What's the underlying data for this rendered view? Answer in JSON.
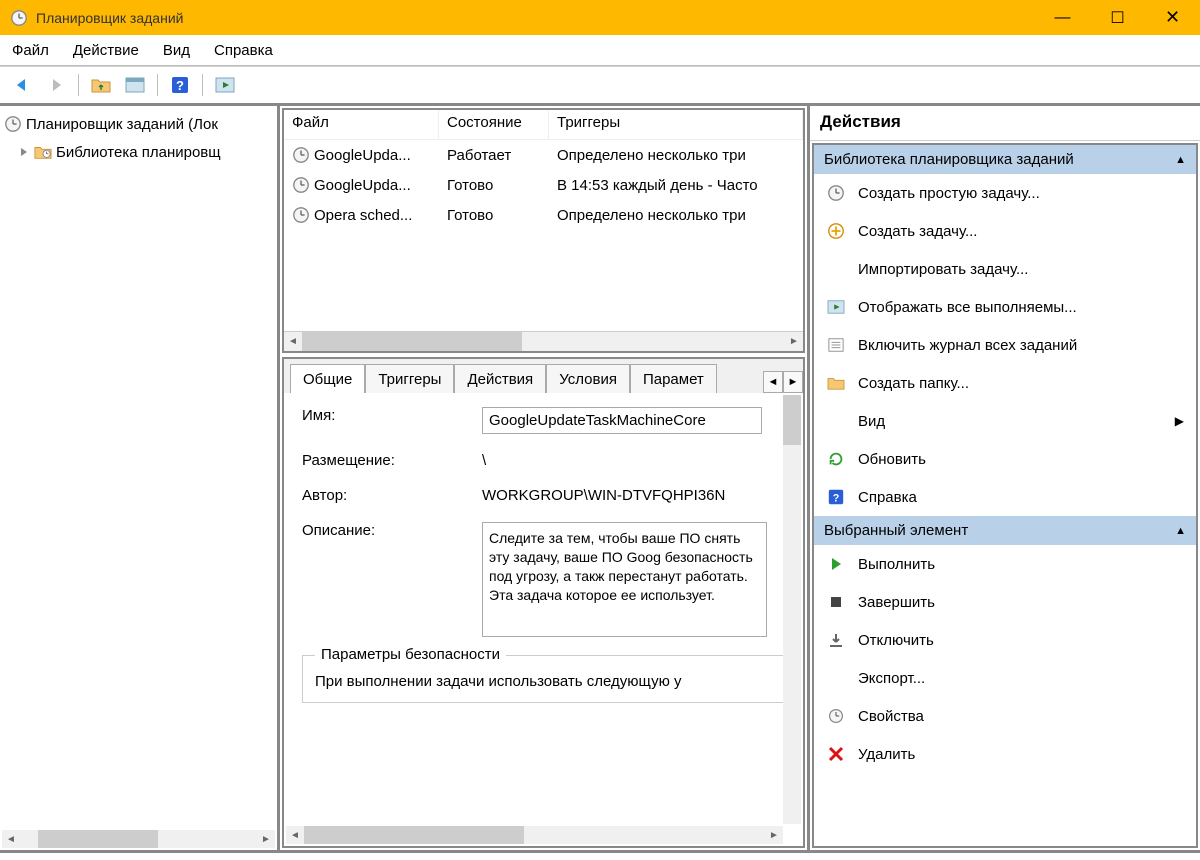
{
  "title": "Планировщик заданий",
  "menu": {
    "file": "Файл",
    "action": "Действие",
    "view": "Вид",
    "help": "Справка"
  },
  "tree": {
    "root": "Планировщик заданий (Лок",
    "lib": "Библиотека планировщ"
  },
  "tasklist": {
    "cols": {
      "c1": "Файл",
      "c2": "Состояние",
      "c3": "Триггеры"
    },
    "rows": [
      {
        "name": "GoogleUpda...",
        "state": "Работает",
        "trig": "Определено несколько три"
      },
      {
        "name": "GoogleUpda...",
        "state": "Готово",
        "trig": "В 14:53 каждый день - Часто"
      },
      {
        "name": "Opera sched...",
        "state": "Готово",
        "trig": "Определено несколько три"
      }
    ]
  },
  "tabs": {
    "t1": "Общие",
    "t2": "Триггеры",
    "t3": "Действия",
    "t4": "Условия",
    "t5": "Парамет"
  },
  "detail": {
    "name_lab": "Имя:",
    "name_val": "GoogleUpdateTaskMachineCore",
    "loc_lab": "Размещение:",
    "loc_val": "\\",
    "author_lab": "Автор:",
    "author_val": "WORKGROUP\\WIN-DTVFQHPI36N",
    "desc_lab": "Описание:",
    "desc_val": "Следите за тем, чтобы ваше ПО снять эту задачу, ваше ПО Goog безопасность под угрозу, а такж перестанут работать. Эта задача которое ее использует.",
    "sec_title": "Параметры безопасности",
    "sec_line": "При выполнении задачи использовать следующую у"
  },
  "actions": {
    "pane_title": "Действия",
    "hdr1": "Библиотека планировщика заданий",
    "a1": "Создать простую задачу...",
    "a2": "Создать задачу...",
    "a3": "Импортировать задачу...",
    "a4": "Отображать все выполняемы...",
    "a5": "Включить журнал всех заданий",
    "a6": "Создать папку...",
    "a7": "Вид",
    "a8": "Обновить",
    "a9": "Справка",
    "hdr2": "Выбранный элемент",
    "b1": "Выполнить",
    "b2": "Завершить",
    "b3": "Отключить",
    "b4": "Экспорт...",
    "b5": "Свойства",
    "b6": "Удалить"
  }
}
